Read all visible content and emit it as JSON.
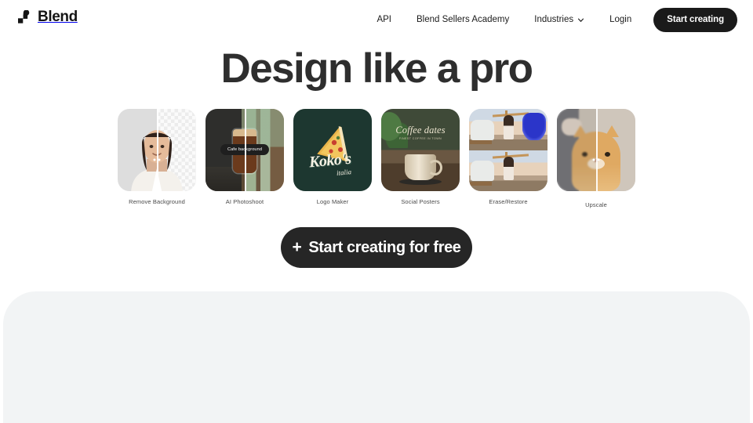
{
  "brand": {
    "name": "Blend",
    "logo_icon": "blend-logo-icon",
    "color": "#151515"
  },
  "header": {
    "nav_items": [
      {
        "label": "API",
        "name": "api"
      },
      {
        "label": "Blend Sellers Academy",
        "name": "blend-sellers-academy"
      },
      {
        "label": "Industries",
        "name": "industries",
        "icon": "chevron-down-icon",
        "has_dropdown": true
      },
      {
        "label": "Login",
        "name": "login"
      }
    ],
    "cta_label": "Start creating",
    "cta_bg": "#1a1a1a",
    "cta_text_color": "#ffffff"
  },
  "hero": {
    "headline": "Design like a pro",
    "headline_color": "#2e2e2e"
  },
  "tools": [
    {
      "label": "Remove Background",
      "name": "remove-background",
      "style": "before-after-vertical",
      "handle_icon": "slider-handle-icon"
    },
    {
      "label": "AI Photoshoot",
      "name": "ai-photoshoot",
      "style": "before-after-vertical",
      "badge": "Cafe background"
    },
    {
      "label": "Logo Maker",
      "name": "logo-maker",
      "style": "logo",
      "logo_word": "Koko's",
      "logo_sub": "italia",
      "bg": "#1d3730",
      "icon": "pizza-slice-icon"
    },
    {
      "label": "Social Posters",
      "name": "social-posters",
      "style": "poster",
      "poster_title": "Coffee dates",
      "poster_tagline": "FINEST COFFEE IN TOWN"
    },
    {
      "label": "Erase/Restore",
      "name": "erase-restore",
      "style": "before-after-stacked"
    },
    {
      "label": "Upscale",
      "name": "upscale",
      "style": "before-after-vertical",
      "label_offset": true
    }
  ],
  "cta": {
    "plus": "+",
    "label": "Start creating for free",
    "bg": "#262626",
    "text_color": "#ffffff"
  },
  "panel": {
    "bg": "#f2f4f5"
  }
}
